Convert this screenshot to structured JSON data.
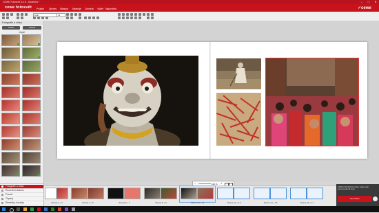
{
  "window": {
    "title": "CEWE Fotosvět 6.4.5 - fotokniha *",
    "min_glyph": "–",
    "max_glyph": "□",
    "close_glyph": "✕"
  },
  "app": {
    "logo_text": "cewe fotosvět",
    "brand": "✓cewe",
    "menu": [
      "Projekt",
      "Úpravy",
      "Stránka",
      "Nástroje",
      "Zobrazit",
      "Výběr",
      "Nápověda"
    ]
  },
  "toolbar": {
    "font_value": "Arial",
    "size_value": "12"
  },
  "sidebar": {
    "header": "Fotografie a videa",
    "btn_add": "Přidat",
    "btn_sort": "Seřadit",
    "group_label": "nepal",
    "sections": [
      {
        "label": "Fotografie a videa",
        "active": true
      },
      {
        "label": "Rozvržení stránek",
        "active": false
      },
      {
        "label": "Pozadí",
        "active": false
      },
      {
        "label": "Cliparty",
        "active": false
      },
      {
        "label": "Rámečky a masky",
        "active": false
      }
    ]
  },
  "zoom": {
    "label": "100 %"
  },
  "filmstrip": {
    "spreads": [
      {
        "label": "Strana 2 + 3"
      },
      {
        "label": "Strana 4 + 5"
      },
      {
        "label": "Strana 6 + 7"
      },
      {
        "label": "Strana 8 + 9"
      },
      {
        "label": "Strana 10 + 11"
      },
      {
        "label": "Strana 12 + 13"
      },
      {
        "label": "Strana 14 + 15"
      },
      {
        "label": "Strana 16 + 17"
      }
    ],
    "order_text": "CEWE FOTOKNIHA Velká, lesklý papír, pevná vazba 26 stran",
    "order_button": "Do košíku"
  },
  "colors": {
    "accent": "#c8121c",
    "selection": "#e0313a"
  }
}
